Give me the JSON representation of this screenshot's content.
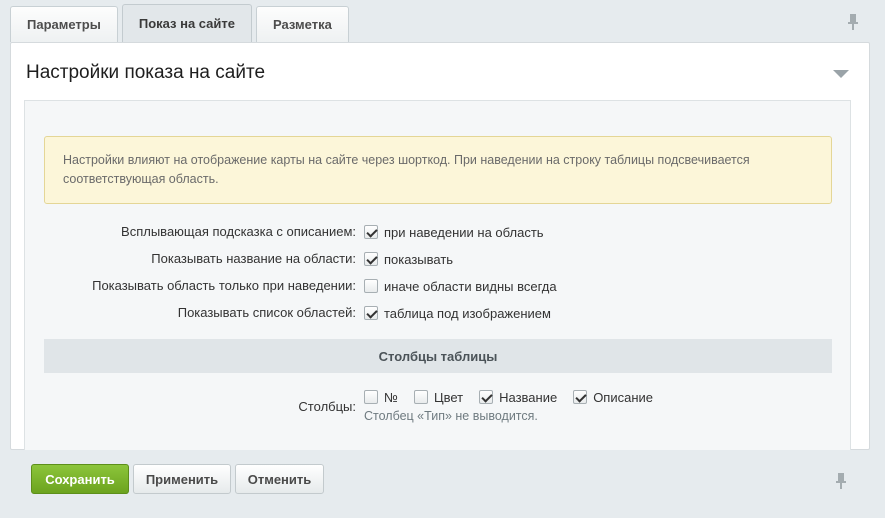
{
  "tabs": [
    {
      "label": "Параметры",
      "active": false
    },
    {
      "label": "Показ на сайте",
      "active": true
    },
    {
      "label": "Разметка",
      "active": false
    }
  ],
  "panel": {
    "title": "Настройки показа на сайте",
    "notice": "Настройки влияют на отображение карты на сайте через шорткод. При наведении на строку таблицы подсвечивается соответствующая область."
  },
  "settings": [
    {
      "label": "Всплывающая подсказка с описанием:",
      "option": "при наведении на область",
      "checked": true
    },
    {
      "label": "Показывать название на области:",
      "option": "показывать",
      "checked": true
    },
    {
      "label": "Показывать область только при наведении:",
      "option": "иначе области видны всегда",
      "checked": false
    },
    {
      "label": "Показывать список областей:",
      "option": "таблица под изображением",
      "checked": true
    }
  ],
  "columns_section": {
    "title": "Столбцы таблицы",
    "label": "Столбцы:",
    "options": [
      {
        "label": "№",
        "checked": false
      },
      {
        "label": "Цвет",
        "checked": false
      },
      {
        "label": "Название",
        "checked": true
      },
      {
        "label": "Описание",
        "checked": true
      }
    ],
    "hint": "Столбец «Тип» не выводится."
  },
  "buttons": {
    "save": "Сохранить",
    "apply": "Применить",
    "cancel": "Отменить"
  },
  "icons": {
    "pin": "pin-icon",
    "collapse": "chevron-down-icon"
  }
}
